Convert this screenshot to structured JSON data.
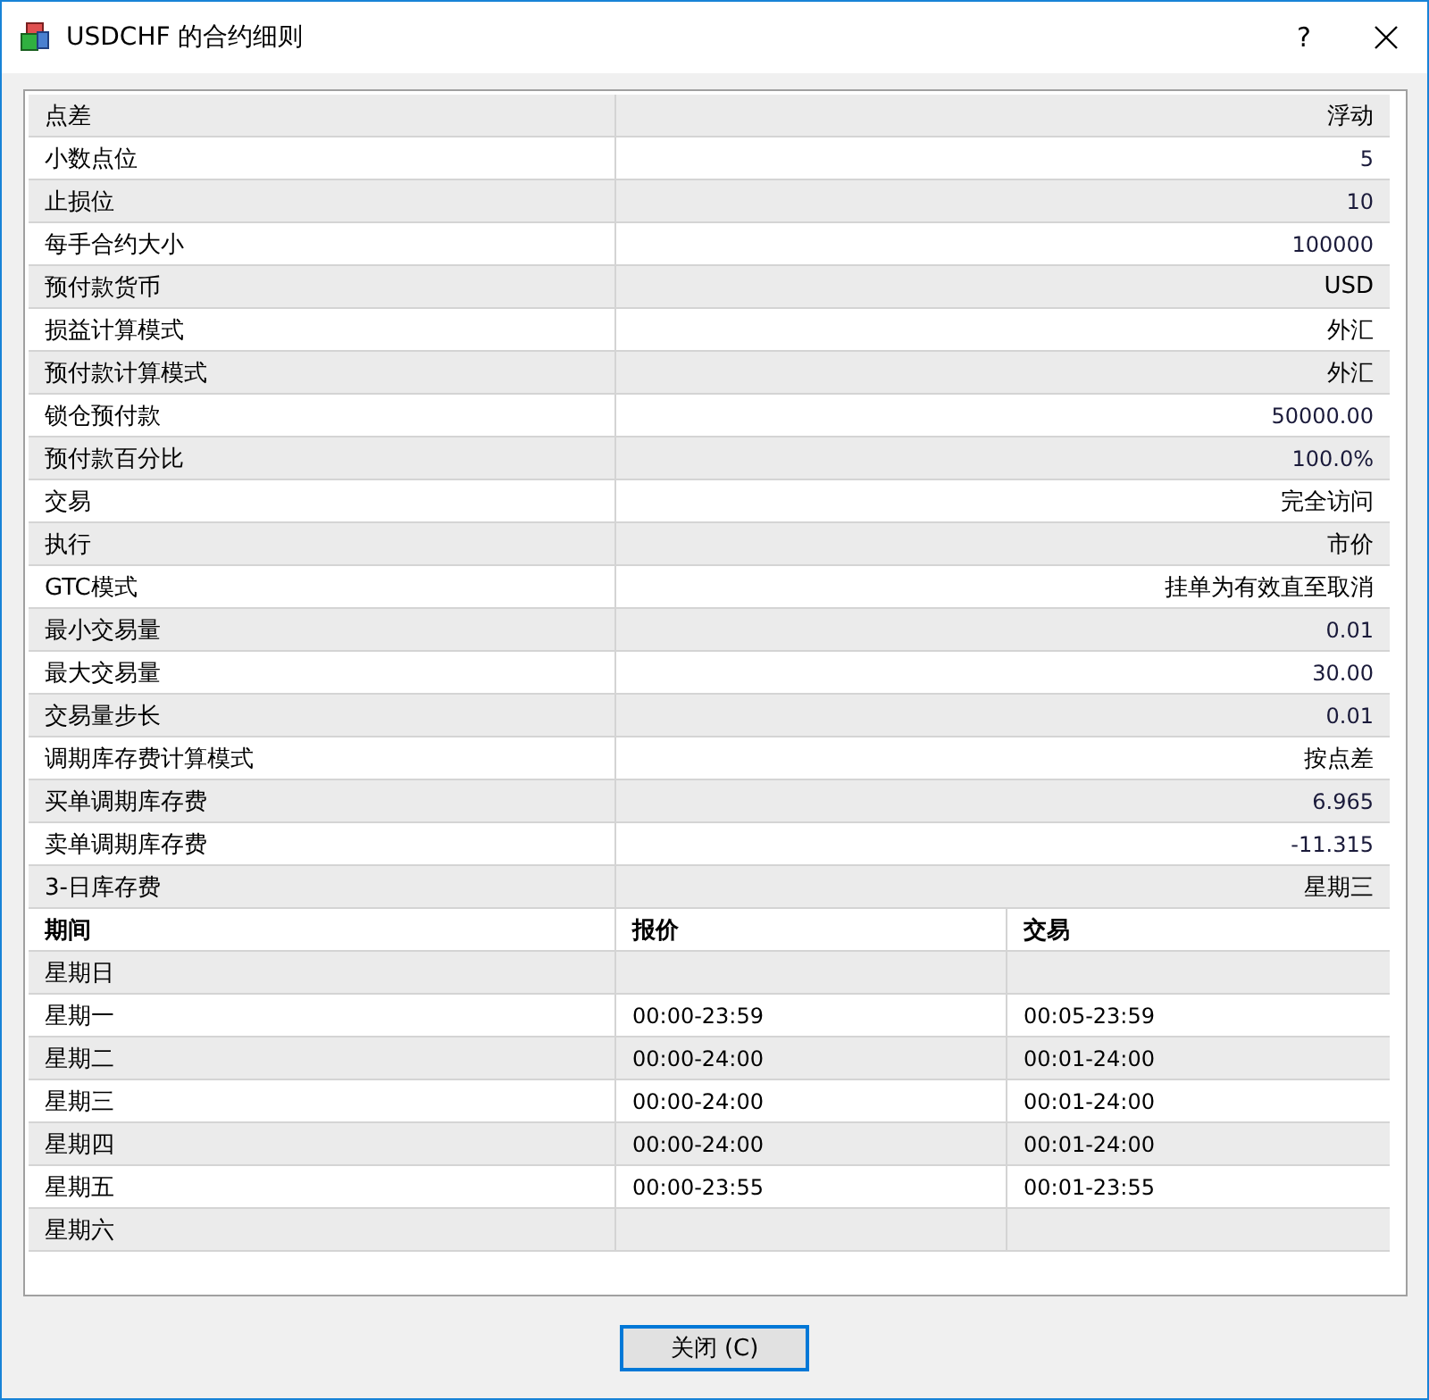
{
  "window": {
    "title": "USDCHF 的合约细则",
    "help": "?"
  },
  "specs": [
    {
      "label": "点差",
      "value": "浮动"
    },
    {
      "label": "小数点位",
      "value": "5"
    },
    {
      "label": "止损位",
      "value": "10"
    },
    {
      "label": "每手合约大小",
      "value": "100000"
    },
    {
      "label": "预付款货币",
      "value": "USD"
    },
    {
      "label": "损益计算模式",
      "value": "外汇"
    },
    {
      "label": "预付款计算模式",
      "value": "外汇"
    },
    {
      "label": "锁仓预付款",
      "value": "50000.00"
    },
    {
      "label": "预付款百分比",
      "value": "100.0%"
    },
    {
      "label": "交易",
      "value": "完全访问"
    },
    {
      "label": "执行",
      "value": "市价"
    },
    {
      "label": "GTC模式",
      "value": "挂单为有效直至取消"
    },
    {
      "label": "最小交易量",
      "value": "0.01"
    },
    {
      "label": "最大交易量",
      "value": "30.00"
    },
    {
      "label": "交易量步长",
      "value": "0.01"
    },
    {
      "label": "调期库存费计算模式",
      "value": "按点差"
    },
    {
      "label": "买单调期库存费",
      "value": "6.965"
    },
    {
      "label": "卖单调期库存费",
      "value": "-11.315"
    },
    {
      "label": "3-日库存费",
      "value": "星期三"
    }
  ],
  "sessions": {
    "columns": [
      "期间",
      "报价",
      "交易"
    ],
    "rows": [
      [
        "星期日",
        "",
        ""
      ],
      [
        "星期一",
        "00:00-23:59",
        "00:05-23:59"
      ],
      [
        "星期二",
        "00:00-24:00",
        "00:01-24:00"
      ],
      [
        "星期三",
        "00:00-24:00",
        "00:01-24:00"
      ],
      [
        "星期四",
        "00:00-24:00",
        "00:01-24:00"
      ],
      [
        "星期五",
        "00:00-23:55",
        "00:01-23:55"
      ],
      [
        "星期六",
        "",
        ""
      ]
    ]
  },
  "buttons": [
    {
      "label": "关闭 (C)"
    }
  ]
}
